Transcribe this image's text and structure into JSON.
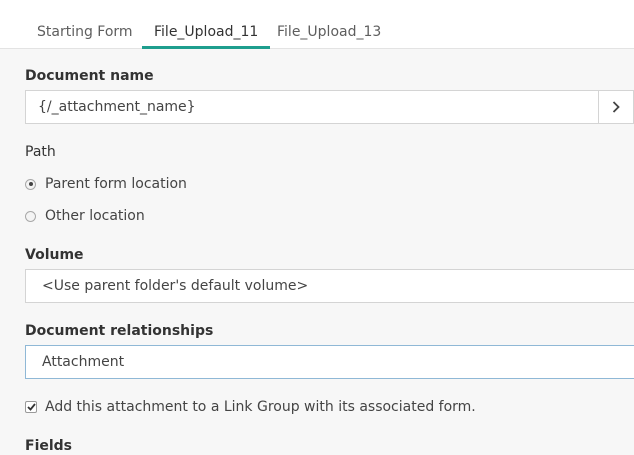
{
  "tabs": [
    {
      "label": "Starting Form",
      "active": false
    },
    {
      "label": "File_Upload_11",
      "active": true
    },
    {
      "label": "File_Upload_13",
      "active": false
    }
  ],
  "form": {
    "document_name": {
      "label": "Document name",
      "value": "{/_attachment_name}"
    },
    "path": {
      "label": "Path",
      "options": [
        {
          "label": "Parent form location",
          "selected": true
        },
        {
          "label": "Other location",
          "selected": false
        }
      ]
    },
    "volume": {
      "label": "Volume",
      "value": "<Use parent folder's default volume>"
    },
    "document_relationships": {
      "label": "Document relationships",
      "value": "Attachment"
    },
    "link_group_checkbox": {
      "label": "Add this attachment to a Link Group with its associated form.",
      "checked": true
    },
    "fields": {
      "label": "Fields"
    }
  },
  "colors": {
    "accent": "#1e9e8e",
    "focus_border": "#8fb8d6",
    "panel_bg": "#f7f7f7"
  },
  "icons": {
    "browse": "chevron-right-icon",
    "checkbox": "checkmark-icon"
  }
}
